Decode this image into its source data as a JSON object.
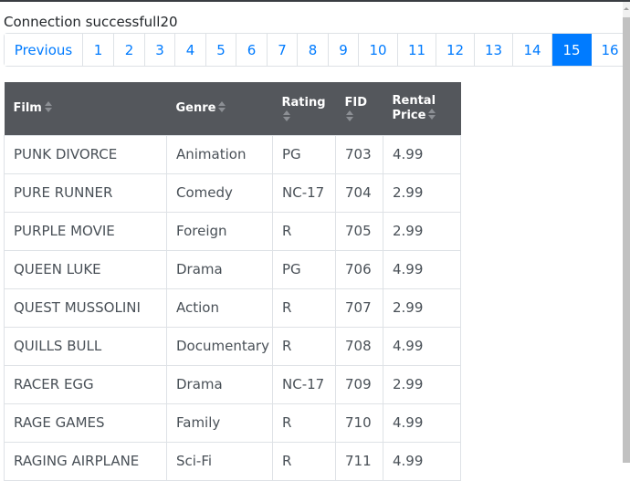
{
  "status_text": "Connection successfull20",
  "pagination": {
    "previous_label": "Previous",
    "pages": [
      "1",
      "2",
      "3",
      "4",
      "5",
      "6",
      "7",
      "8",
      "9",
      "10",
      "11",
      "12",
      "13",
      "14",
      "15",
      "16"
    ],
    "active_page": "15",
    "active_color": "#007bff"
  },
  "table": {
    "headers": [
      {
        "label": "Film",
        "sort_icon": "sort-icon"
      },
      {
        "label": "Genre",
        "sort_icon": "sort-icon"
      },
      {
        "label": "Rating",
        "sort_icon": "sort-icon"
      },
      {
        "label": "FID",
        "sort_icon": "sort-icon"
      },
      {
        "label": "Rental Price",
        "label_line1": "Rental",
        "label_line2": "Price",
        "sort_icon": "sort-icon"
      }
    ],
    "rows": [
      {
        "film": "PUNK DIVORCE",
        "genre": "Animation",
        "rating": "PG",
        "fid": "703",
        "price": "4.99"
      },
      {
        "film": "PURE RUNNER",
        "genre": "Comedy",
        "rating": "NC-17",
        "fid": "704",
        "price": "2.99"
      },
      {
        "film": "PURPLE MOVIE",
        "genre": "Foreign",
        "rating": "R",
        "fid": "705",
        "price": "2.99"
      },
      {
        "film": "QUEEN LUKE",
        "genre": "Drama",
        "rating": "PG",
        "fid": "706",
        "price": "4.99"
      },
      {
        "film": "QUEST MUSSOLINI",
        "genre": "Action",
        "rating": "R",
        "fid": "707",
        "price": "2.99"
      },
      {
        "film": "QUILLS BULL",
        "genre": "Documentary",
        "rating": "R",
        "fid": "708",
        "price": "4.99"
      },
      {
        "film": "RACER EGG",
        "genre": "Drama",
        "rating": "NC-17",
        "fid": "709",
        "price": "2.99"
      },
      {
        "film": "RAGE GAMES",
        "genre": "Family",
        "rating": "R",
        "fid": "710",
        "price": "4.99"
      },
      {
        "film": "RAGING AIRPLANE",
        "genre": "Sci-Fi",
        "rating": "R",
        "fid": "711",
        "price": "4.99"
      }
    ]
  }
}
